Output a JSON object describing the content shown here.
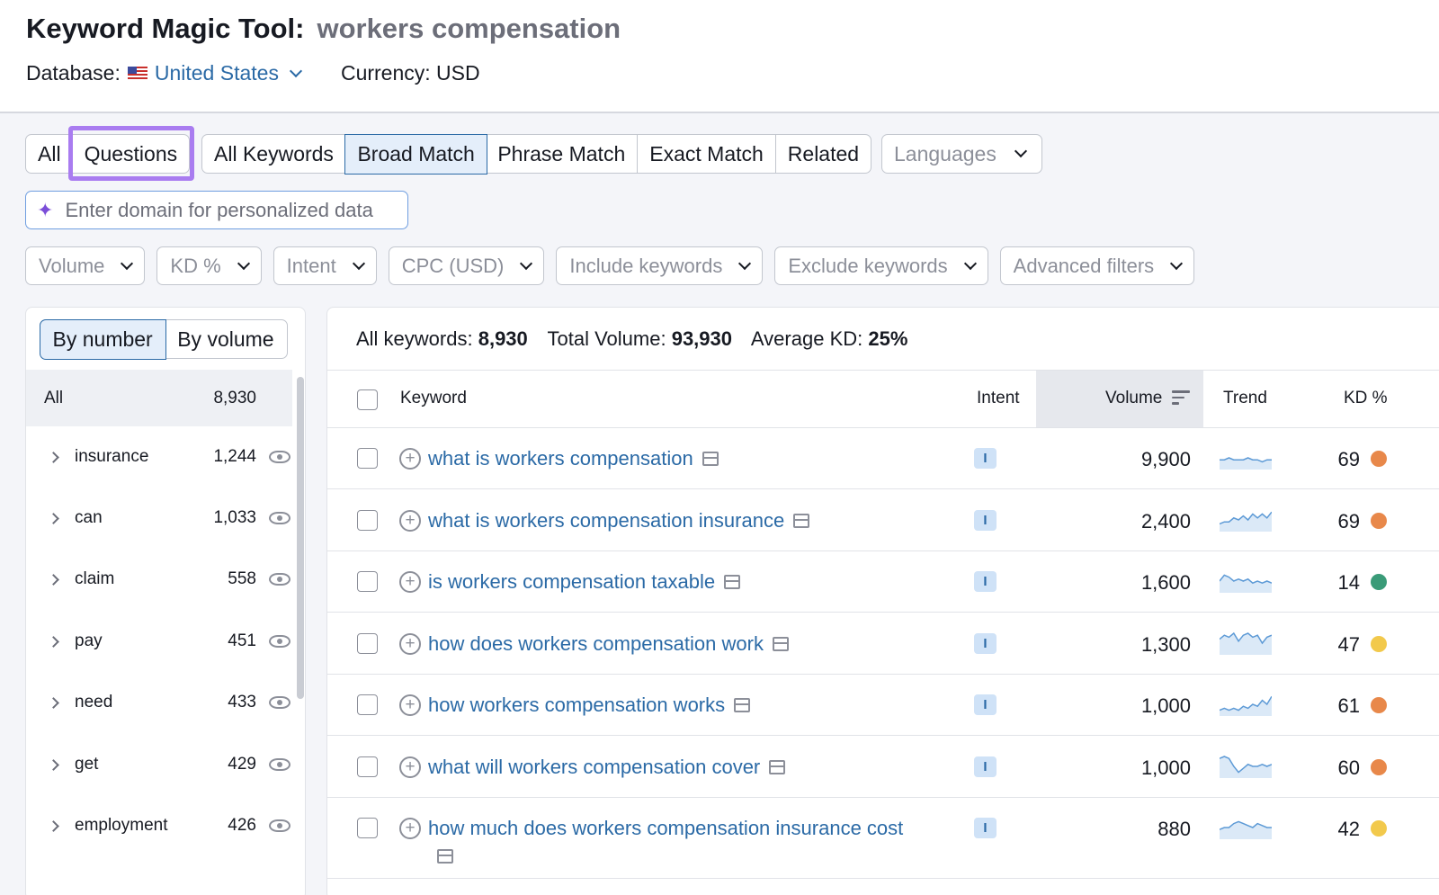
{
  "header": {
    "tool_title": "Keyword Magic Tool:",
    "query": "workers compensation",
    "database_label": "Database:",
    "database_value": "United States",
    "currency_label": "Currency: USD"
  },
  "tabs_group1": [
    "All",
    "Questions"
  ],
  "tabs_group2": [
    "All Keywords",
    "Broad Match",
    "Phrase Match",
    "Exact Match",
    "Related"
  ],
  "languages_label": "Languages",
  "domain_placeholder": "Enter domain for personalized data",
  "filters": [
    "Volume",
    "KD %",
    "Intent",
    "CPC (USD)",
    "Include keywords",
    "Exclude keywords",
    "Advanced filters"
  ],
  "left_panel": {
    "toggle": [
      "By number",
      "By volume"
    ],
    "all_label": "All",
    "all_count": "8,930",
    "groups": [
      {
        "label": "insurance",
        "count": "1,244"
      },
      {
        "label": "can",
        "count": "1,033"
      },
      {
        "label": "claim",
        "count": "558"
      },
      {
        "label": "pay",
        "count": "451"
      },
      {
        "label": "need",
        "count": "433"
      },
      {
        "label": "get",
        "count": "429"
      },
      {
        "label": "employment",
        "count": "426"
      }
    ]
  },
  "summary": {
    "all_keywords_label": "All keywords:",
    "all_keywords_value": "8,930",
    "total_volume_label": "Total Volume:",
    "total_volume_value": "93,930",
    "avg_kd_label": "Average KD:",
    "avg_kd_value": "25%"
  },
  "table": {
    "headers": {
      "keyword": "Keyword",
      "intent": "Intent",
      "volume": "Volume",
      "trend": "Trend",
      "kd": "KD %"
    },
    "rows": [
      {
        "keyword": "what is workers compensation",
        "intent": "I",
        "volume": "9,900",
        "kd": "69",
        "kd_color": "#e8884a",
        "trend": [
          4,
          4,
          5,
          4,
          4,
          4,
          5,
          4,
          4,
          3,
          4,
          4
        ]
      },
      {
        "keyword": "what is workers compensation insurance",
        "intent": "I",
        "volume": "2,400",
        "kd": "69",
        "kd_color": "#e8884a",
        "trend": [
          3,
          4,
          4,
          6,
          5,
          7,
          5,
          8,
          6,
          8,
          6,
          9
        ]
      },
      {
        "keyword": "is workers compensation taxable",
        "intent": "I",
        "volume": "1,600",
        "kd": "14",
        "kd_color": "#3a9b78",
        "trend": [
          5,
          8,
          7,
          5,
          6,
          5,
          6,
          4,
          5,
          4,
          5,
          4
        ]
      },
      {
        "keyword": "how does workers compensation work",
        "intent": "I",
        "volume": "1,300",
        "kd": "47",
        "kd_color": "#f2c94c",
        "trend": [
          7,
          9,
          8,
          10,
          6,
          9,
          10,
          8,
          9,
          5,
          8,
          9
        ]
      },
      {
        "keyword": "how workers compensation works",
        "intent": "I",
        "volume": "1,000",
        "kd": "61",
        "kd_color": "#e8884a",
        "trend": [
          2,
          3,
          2,
          3,
          2,
          4,
          3,
          5,
          4,
          7,
          5,
          9
        ]
      },
      {
        "keyword": "what will workers compensation cover",
        "intent": "I",
        "volume": "1,000",
        "kd": "60",
        "kd_color": "#e8884a",
        "trend": [
          9,
          10,
          9,
          5,
          2,
          4,
          6,
          5,
          5,
          6,
          5,
          6
        ]
      },
      {
        "keyword": "how much does workers compensation insurance cost",
        "intent": "I",
        "volume": "880",
        "kd": "42",
        "kd_color": "#f2c94c",
        "trend": [
          4,
          5,
          5,
          7,
          8,
          7,
          6,
          5,
          7,
          6,
          5,
          5
        ]
      }
    ]
  },
  "colors": {
    "accent": "#2b6aa6",
    "highlight": "#a97cf0"
  }
}
